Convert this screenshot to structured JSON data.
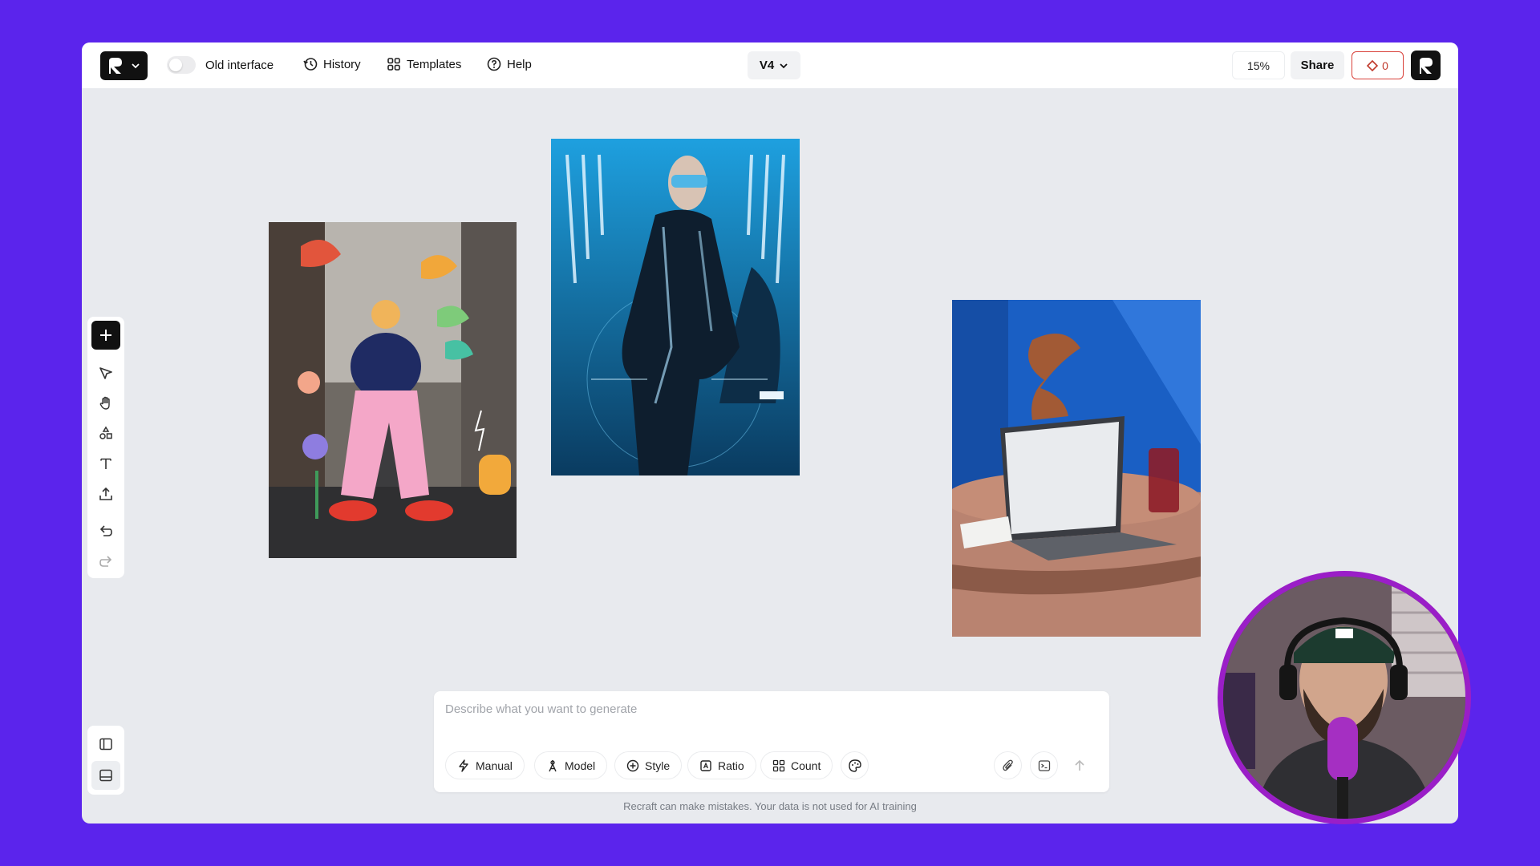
{
  "topbar": {
    "toggle_label": "Old interface",
    "nav": [
      {
        "label": "History",
        "icon": "history-icon"
      },
      {
        "label": "Templates",
        "icon": "templates-icon"
      },
      {
        "label": "Help",
        "icon": "help-icon"
      }
    ],
    "version": "V4",
    "zoom": "15%",
    "share": "Share",
    "credits": "0"
  },
  "toolbar": {
    "tools": [
      "add-icon",
      "select-icon",
      "hand-icon",
      "shapes-icon",
      "text-icon",
      "upload-icon",
      "undo-icon",
      "redo-icon"
    ]
  },
  "prompt": {
    "placeholder": "Describe what you want to generate",
    "buttons": [
      {
        "label": "Manual",
        "icon": "lightning-icon"
      },
      {
        "label": "Model",
        "icon": "model-icon"
      },
      {
        "label": "Style",
        "icon": "plus-circle-icon"
      },
      {
        "label": "Ratio",
        "icon": "ratio-icon"
      },
      {
        "label": "Count",
        "icon": "grid-icon"
      }
    ]
  },
  "disclaimer": "Recraft can make mistakes. Your data is not used for AI training",
  "colors": {
    "background": "#5b24ec",
    "canvas": "#e8eaee",
    "credits_accent": "#d9413a",
    "webcam_ring": "#9a1ec7"
  }
}
